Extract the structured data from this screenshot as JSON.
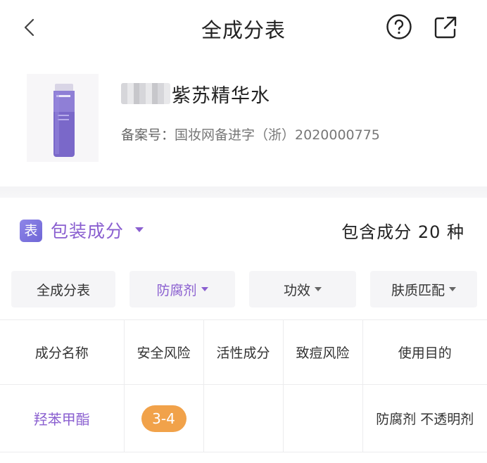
{
  "header": {
    "title": "全成分表"
  },
  "product": {
    "name_suffix": "紫苏精华水",
    "record_label": "备案号：",
    "record_value": "国妆网备进字（浙）2020000775"
  },
  "section": {
    "badge": "表",
    "label": "包装成分",
    "count_text": "包含成分 20 种"
  },
  "filters": [
    {
      "label": "全成分表"
    },
    {
      "label": "防腐剂"
    },
    {
      "label": "功效"
    },
    {
      "label": "肤质匹配"
    }
  ],
  "table": {
    "columns": [
      "成分名称",
      "安全风险",
      "活性成分",
      "致痘风险",
      "使用目的"
    ],
    "rows": [
      {
        "name": "羟苯甲酯",
        "risk": "3-4",
        "active": "",
        "acne": "",
        "purpose": "防腐剂 不透明剂"
      }
    ]
  },
  "colors": {
    "accent": "#8a5fd0",
    "risk": "#f1a24a"
  }
}
